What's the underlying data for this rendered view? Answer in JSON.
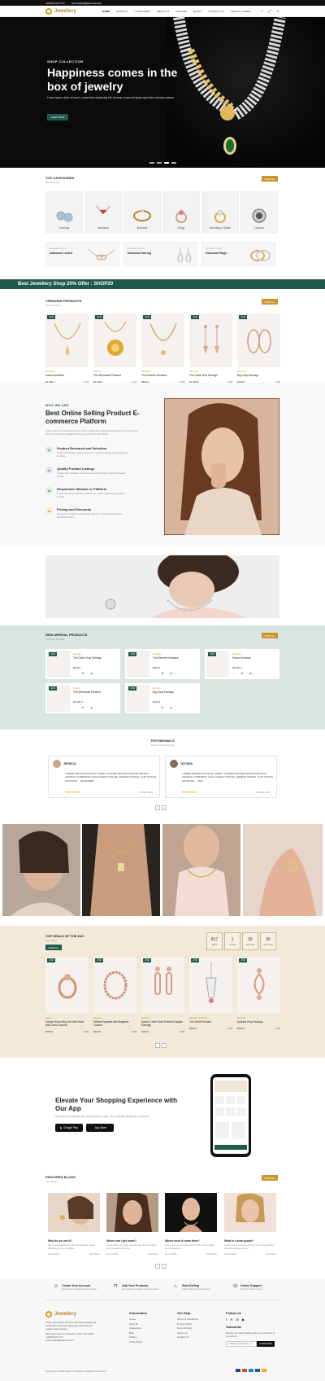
{
  "topbar": {
    "phone": "+1(800) 444-7717",
    "email": "sparrowpath@fakemail.com"
  },
  "brand": {
    "name": "Jewellery",
    "accent": "#c8952e",
    "green": "#1f5a4a"
  },
  "nav": {
    "items": [
      "HOME",
      "SHOP ALL",
      "CATEGORIES",
      "ABOUT US",
      "GALLERY",
      "BLOGS",
      "CONTACT US",
      "VIEW MY ORDER"
    ],
    "icons": [
      "search-icon",
      "cart-icon",
      "user-icon"
    ],
    "cart_count": "0"
  },
  "hero": {
    "eyebrow": "SHOP COLLECTION",
    "title": "Happiness comes in the box of jewelry",
    "desc": "Lorem ipsum dolor sit amet, consectetur adipiscing elit. Aenean commodo ligula eget dolor. Aenean massa.",
    "button": "SHOP NOW"
  },
  "categories": {
    "title": "TOP CATEGORIES",
    "subtitle": "Visit Sub Cat",
    "view_all": "VIEW ALL",
    "items": [
      "Earrings",
      "Necklace",
      "Bracelet",
      "Rings",
      "Wedding & Bridal",
      "Charms"
    ]
  },
  "promos": [
    {
      "small": "Get 40% Off on",
      "title": "Diamond Locket"
    },
    {
      "small": "Get 20% Off on",
      "title": "Diamond Earring"
    },
    {
      "small": "Get 30% Off on",
      "title": "Diamond Rings"
    }
  ],
  "offer_banner": "Best Jewellery Shop 20% Offer : SHOP20",
  "trending": {
    "title": "TRENDING PRODUCTS",
    "subtitle": "Visit Trending",
    "view_all": "VIEW ALL",
    "items": [
      {
        "badge": "-15%",
        "cat": "Necklace",
        "name": "Kacha Necklace",
        "price": "$1,550.0",
        "rating": "4.5"
      },
      {
        "badge": "-11%",
        "cat": "Charms",
        "name": "The Whimsical Pendant",
        "price": "$1,600.0",
        "rating": "4.0"
      },
      {
        "badge": "-10%",
        "cat": "Necklace",
        "name": "The Dimetre Necklace",
        "price": "$899.0",
        "rating": "4.5"
      },
      {
        "badge": "-15%",
        "cat": "Earrings",
        "name": "The Callie Drop Earrings",
        "price": "$1,250.0",
        "rating": "4.5"
      },
      {
        "badge": "-15%",
        "cat": "Earrings",
        "name": "Big Hoop Earrings",
        "price": "$199.0",
        "rating": "4.5"
      }
    ]
  },
  "about": {
    "eyebrow": "WHO WE ARE",
    "title": "Best Online Selling Product E-commerce Platform",
    "desc": "Lorem Ipsum is simply dummy text of the printing and typesetting industry. Lorem Ipsum has been the industry's standard dummy text ever since the 1500s.",
    "features": [
      {
        "num": "01",
        "title": "Product Research and Selection",
        "desc": "Conduct thorough market research to identify trending and in-demand products.",
        "color": "#dfe9e6"
      },
      {
        "num": "02",
        "title": "Quality Product Listings",
        "desc": "Create clear, detailed, and accurate product listings with high-quality images.",
        "color": "#e8e0f2"
      },
      {
        "num": "03",
        "title": "Responsive Website or Platform",
        "desc": "Ensure that your website or platform is mobile-responsive and user-friendly.",
        "color": "#dfeee0"
      },
      {
        "num": "04",
        "title": "Pricing and Discounts",
        "desc": "Price your products competitively based on market research and production costs.",
        "color": "#f7ecd0"
      }
    ]
  },
  "arrivals": {
    "title": "NEW ARRIVAL PRODUCTS",
    "subtitle": "Visit New Arrivals",
    "view_all": "VIEW ALL",
    "items": [
      {
        "badge": "-15%",
        "cat": "Earrings",
        "name": "The Callie Drop Earrings",
        "price": "$499.0"
      },
      {
        "badge": "-10%",
        "cat": "Necklace",
        "name": "The Dimetre Necklace",
        "price": "$999.0"
      },
      {
        "badge": "-15%",
        "cat": "Necklace",
        "name": "Kacha Necklace",
        "price": "$1,550.0"
      },
      {
        "badge": "-11%",
        "cat": "Charms",
        "name": "The Whimsical Pendant",
        "price": "$1,600.0"
      },
      {
        "badge": "-15%",
        "cat": "Earrings",
        "name": "Big Hoop Earrings",
        "price": "$199.0"
      }
    ]
  },
  "testimonials": {
    "title": "TESTIMONIALS",
    "subtitle": "What Our Clients Say",
    "items": [
      {
        "name": "JESSICA",
        "quote": "Lorem ipsum dolor sit amet, consectetuer adipiscing elit. Aenean commodo ligula eget dolor. Aenean massa. Cum sociis natoque... designer",
        "date": "04 SEP 2023"
      },
      {
        "name": "TATIANA",
        "quote": "Lorem ipsum dolor sit amet, consectetuer adipiscing elit. Aenean commodo ligula eget dolor. Aenean massa. Cum sociis natoque... CEO",
        "date": "04 SEP 2023"
      }
    ]
  },
  "deals": {
    "title": "TOP DEALS OF THE DAY",
    "subtitle": "Visit Deals",
    "view_all": "VIEW ALL",
    "timer": [
      {
        "n": "817",
        "l": "DAYS"
      },
      {
        "n": "1",
        "l": "HOURS"
      },
      {
        "n": "30",
        "l": "MINUTES"
      },
      {
        "n": "30",
        "l": "SECONDS"
      }
    ],
    "items": [
      {
        "badge": "-15%",
        "cat": "Rings",
        "name": "Golden Rose Ring Set with Heart and Cubic Zirconia",
        "price": "$750.0",
        "rating": "4.5"
      },
      {
        "badge": "-15%",
        "cat": "Bracelet",
        "name": "Fireline Bracelet with Magnetic Closure",
        "price": "$499.0",
        "rating": "4.5"
      },
      {
        "badge": "-15%",
        "cat": "Earrings",
        "name": "Harmo Chain Rose Element Dangle Earrings",
        "price": "$150.0",
        "rating": "4.5"
      },
      {
        "badge": "-17%",
        "cat": "Wedding & Bridal",
        "name": "The Viella Pendant",
        "price": "$299.0",
        "rating": "4.5"
      },
      {
        "badge": "-15%",
        "cat": "Earrings",
        "name": "Audrina Drop Earrings",
        "price": "$490.0",
        "rating": "4.5"
      }
    ]
  },
  "app": {
    "title": "Elevate Your Shopping Experience with Our App",
    "desc": "Shop Now and Shopify with Our Exclusive in App - Your Ultimate Shopping Companion!",
    "google": "Google Play",
    "apple": "App Store"
  },
  "blogs": {
    "title": "FEATURED BLOGS",
    "subtitle": "Visit Blogs",
    "view_all": "VIEW ALL",
    "items": [
      {
        "title": "Why do we use it?",
        "desc": "It is a long established fact that a reader will be distracted by the readable.",
        "date": "02 Oct 2023",
        "more": "Read More"
      },
      {
        "title": "Where can I get some?",
        "desc": "Lorem Ipsum is simply dummy text of the printing and typesetting industry.",
        "date": "02 Oct 2023",
        "more": "Read More"
      },
      {
        "title": "Where does it come from?",
        "desc": "Lorem Ipsum is simply dummy text of the printing and typesetting.",
        "date": "02 Oct 2023",
        "more": "Read More"
      },
      {
        "title": "What is Lorem Ipsum?",
        "desc": "Lorem Ipsum is simply dummy text of the printing and typesetting industry.",
        "date": "02 Oct 2023",
        "more": "Read More"
      }
    ]
  },
  "services": [
    {
      "title": "Create Your Account",
      "desc": "Get access to exlusive Club and offer",
      "icon": "user-icon"
    },
    {
      "title": "Add Your Products",
      "desc": "Get exclusive products and accessories",
      "icon": "bag-icon"
    },
    {
      "title": "Start Selling",
      "desc": "Create Offer for your business",
      "icon": "tag-icon"
    },
    {
      "title": "Online Support",
      "desc": "Get 24/7 online support",
      "icon": "headset-icon"
    }
  ],
  "footer": {
    "about": "Lorem ipsum dolor sit amet consectetur adipiscing elit Aenean commodo ligula eget dolor Aenean massa sociis natoque.",
    "address": "245 Ocean Avenue, Hamptons, New York 10017",
    "phone": "+1(800)444-7717",
    "email": "sparrowpath@fakemail.com",
    "information": {
      "title": "Information",
      "links": [
        "Home",
        "Shop All",
        "Categories",
        "Blog",
        "Gallery",
        "Track Order"
      ]
    },
    "help": {
      "title": "Get Help",
      "links": [
        "Terms & Conditions",
        "Privacy Policy",
        "Refund Policy",
        "About Us",
        "Contact Us"
      ]
    },
    "follow": {
      "title": "Follow Us"
    },
    "subscribe": {
      "title": "Subscribe",
      "desc": "Receive our latest updates about our products & promotions",
      "placeholder": "email@abcd@example.com",
      "button": "SUBSCRIBE"
    },
    "copyright": "Copyright © 2023 Neon IT Solution. All Rights Reserved."
  }
}
